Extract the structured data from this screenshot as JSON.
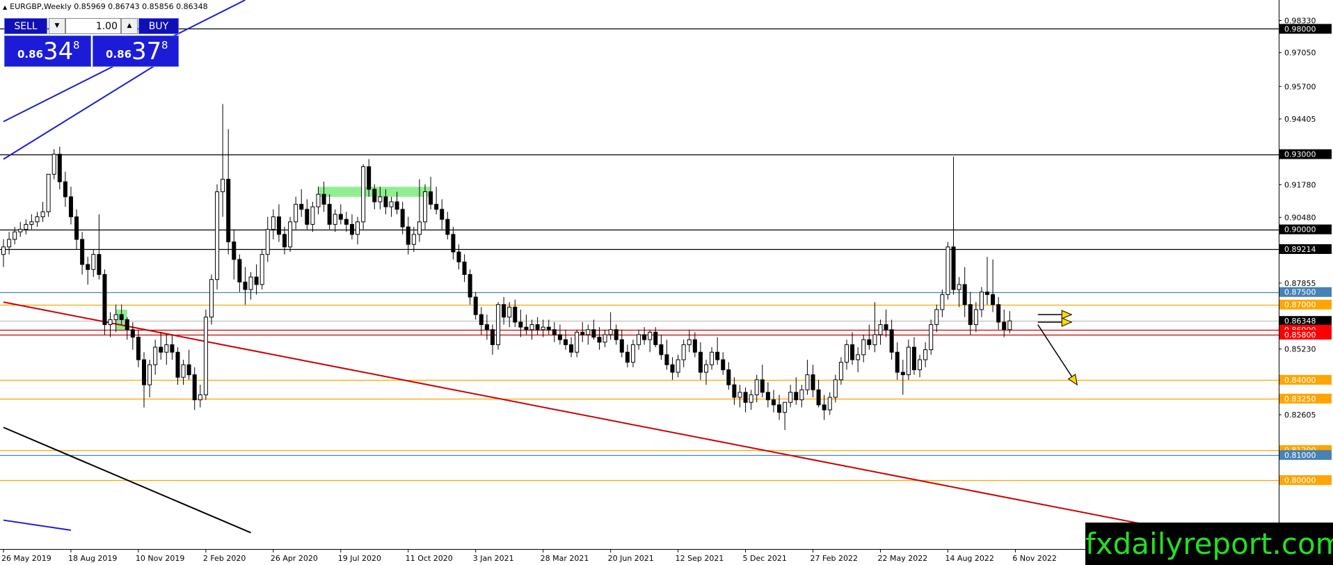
{
  "header": {
    "symbol_line": "EURGBP,Weekly  0.85969 0.86743 0.85856 0.86348"
  },
  "trade_panel": {
    "sell_label": "SELL",
    "buy_label": "BUY",
    "lot_value": "1.00",
    "bid_prefix": "0.86",
    "bid_big": "34",
    "bid_sup": "8",
    "ask_prefix": "0.86",
    "ask_big": "37",
    "ask_sup": "8"
  },
  "watermark": "fxdailyreport.com",
  "chart_data": {
    "type": "candlestick",
    "title": "EURGBP,Weekly",
    "ohlc_readout": [
      0.85969,
      0.86743,
      0.85856,
      0.86348
    ],
    "ylim": [
      0.7725,
      0.9915
    ],
    "price_scale_labels": [
      "0.98330",
      "0.97050",
      "0.95700",
      "0.94405",
      "0.91780",
      "0.90480",
      "0.87855",
      "0.85230",
      "0.82605",
      "0.81200",
      "0.80000"
    ],
    "x_labels": [
      {
        "label": "26 May 2019",
        "i": 0
      },
      {
        "label": "18 Aug 2019",
        "i": 12
      },
      {
        "label": "10 Nov 2019",
        "i": 24
      },
      {
        "label": "2 Feb 2020",
        "i": 36
      },
      {
        "label": "26 Apr 2020",
        "i": 48
      },
      {
        "label": "19 Jul 2020",
        "i": 60
      },
      {
        "label": "11 Oct 2020",
        "i": 72
      },
      {
        "label": "3 Jan 2021",
        "i": 84
      },
      {
        "label": "28 Mar 2021",
        "i": 96
      },
      {
        "label": "20 Jun 2021",
        "i": 108
      },
      {
        "label": "12 Sep 2021",
        "i": 120
      },
      {
        "label": "5 Dec 2021",
        "i": 132
      },
      {
        "label": "27 Feb 2022",
        "i": 144
      },
      {
        "label": "22 May 2022",
        "i": 156
      },
      {
        "label": "14 Aug 2022",
        "i": 168
      },
      {
        "label": "6 Nov 2022",
        "i": 180
      }
    ],
    "levels": [
      {
        "price": 0.98,
        "label": "0.98000",
        "color": "#000000",
        "label_bg": "#000000",
        "label_fg": "#ffffff"
      },
      {
        "price": 0.93,
        "label": "0.93000",
        "color": "#000000",
        "label_bg": "#000000",
        "label_fg": "#ffffff"
      },
      {
        "price": 0.9,
        "label": "0.90000",
        "color": "#000000",
        "label_bg": "#000000",
        "label_fg": "#ffffff"
      },
      {
        "price": 0.89214,
        "label": "0.89214",
        "color": "#000000",
        "label_bg": "#000000",
        "label_fg": "#ffffff"
      },
      {
        "price": 0.875,
        "label": "0.87500",
        "color": "#4682b4",
        "label_bg": "#4682b4",
        "label_fg": "#ffffff"
      },
      {
        "price": 0.87,
        "label": "0.87000",
        "color": "#ffa500",
        "label_bg": "#ffa500",
        "label_fg": "#ffffff"
      },
      {
        "price": 0.86348,
        "label": "0.86348",
        "color": "#c0c0c0",
        "label_bg": "#000000",
        "label_fg": "#ffffff"
      },
      {
        "price": 0.86,
        "label": "0.86000",
        "color": "#cc0000",
        "label_bg": "#ff0000",
        "label_fg": "#ffffff"
      },
      {
        "price": 0.858,
        "label": "0.85800",
        "color": "#cc0000",
        "label_bg": "#ff0000",
        "label_fg": "#ffffff"
      },
      {
        "price": 0.84,
        "label": "0.84000",
        "color": "#ffa500",
        "label_bg": "#ffa500",
        "label_fg": "#ffffff"
      },
      {
        "price": 0.8325,
        "label": "0.83250",
        "color": "#ffa500",
        "label_bg": "#ffa500",
        "label_fg": "#ffffff"
      },
      {
        "price": 0.812,
        "label": "0.81200",
        "color": "#ffa500",
        "label_bg": "#ffa500",
        "label_fg": "#ffffff"
      },
      {
        "price": 0.81,
        "label": "0.81000",
        "color": "#4682b4",
        "label_bg": "#4682b4",
        "label_fg": "#ffffff"
      },
      {
        "price": 0.8,
        "label": "0.80000",
        "color": "#ffa500",
        "label_bg": "#ffa500",
        "label_fg": "#ffffff"
      }
    ],
    "trendlines": [
      {
        "color": "#1c1cd8",
        "i1": 0,
        "p1": 0.943,
        "i2": 43,
        "p2": 0.9915
      },
      {
        "color": "#1c1cd8",
        "i1": 0,
        "p1": 0.928,
        "i2": 31,
        "p2": 0.971
      },
      {
        "color": "#1c1cd8",
        "i1": 0,
        "p1": 0.784,
        "i2": 12,
        "p2": 0.78
      },
      {
        "color": "#cc0000",
        "i1": 0,
        "p1": 0.871,
        "i2": 206,
        "p2": 0.781
      },
      {
        "color": "#000000",
        "i1": 0,
        "p1": 0.821,
        "i2": 44,
        "p2": 0.779
      }
    ],
    "zones": [
      {
        "i1": 56,
        "i2": 76,
        "p1": 0.917,
        "p2": 0.913,
        "color": "#90ee90"
      },
      {
        "i1": 20,
        "i2": 22,
        "p1": 0.868,
        "p2": 0.86,
        "color": "#90ee90"
      }
    ],
    "arrows": [
      {
        "i1": 184,
        "p1": 0.866,
        "i2": 190,
        "p2": 0.866,
        "color": "#ffd700"
      },
      {
        "i1": 184,
        "p1": 0.863,
        "i2": 190,
        "p2": 0.863,
        "color": "#ffd700"
      },
      {
        "i1": 184,
        "p1": 0.862,
        "i2": 191,
        "p2": 0.838,
        "color": "#ffd700"
      }
    ],
    "candles": [
      [
        0.89,
        0.896,
        0.885,
        0.893
      ],
      [
        0.893,
        0.899,
        0.89,
        0.896
      ],
      [
        0.896,
        0.901,
        0.894,
        0.899
      ],
      [
        0.899,
        0.903,
        0.897,
        0.9
      ],
      [
        0.9,
        0.904,
        0.898,
        0.902
      ],
      [
        0.902,
        0.906,
        0.9,
        0.903
      ],
      [
        0.903,
        0.907,
        0.901,
        0.905
      ],
      [
        0.905,
        0.911,
        0.903,
        0.907
      ],
      [
        0.907,
        0.917,
        0.905,
        0.922
      ],
      [
        0.922,
        0.932,
        0.92,
        0.93
      ],
      [
        0.93,
        0.933,
        0.916,
        0.919
      ],
      [
        0.919,
        0.923,
        0.909,
        0.913
      ],
      [
        0.913,
        0.917,
        0.902,
        0.905
      ],
      [
        0.905,
        0.908,
        0.892,
        0.896
      ],
      [
        0.896,
        0.899,
        0.882,
        0.886
      ],
      [
        0.886,
        0.889,
        0.878,
        0.884
      ],
      [
        0.884,
        0.892,
        0.881,
        0.89
      ],
      [
        0.89,
        0.906,
        0.88,
        0.882
      ],
      [
        0.882,
        0.884,
        0.858,
        0.862
      ],
      [
        0.862,
        0.867,
        0.857,
        0.864
      ],
      [
        0.864,
        0.87,
        0.859,
        0.866
      ],
      [
        0.866,
        0.87,
        0.862,
        0.864
      ],
      [
        0.864,
        0.865,
        0.856,
        0.86
      ],
      [
        0.86,
        0.863,
        0.852,
        0.857
      ],
      [
        0.857,
        0.86,
        0.845,
        0.848
      ],
      [
        0.848,
        0.851,
        0.829,
        0.838
      ],
      [
        0.838,
        0.848,
        0.833,
        0.846
      ],
      [
        0.846,
        0.856,
        0.842,
        0.853
      ],
      [
        0.853,
        0.859,
        0.848,
        0.851
      ],
      [
        0.851,
        0.858,
        0.846,
        0.854
      ],
      [
        0.854,
        0.858,
        0.848,
        0.851
      ],
      [
        0.851,
        0.853,
        0.838,
        0.841
      ],
      [
        0.841,
        0.848,
        0.838,
        0.846
      ],
      [
        0.846,
        0.852,
        0.84,
        0.842
      ],
      [
        0.842,
        0.845,
        0.828,
        0.832
      ],
      [
        0.832,
        0.838,
        0.829,
        0.834
      ],
      [
        0.834,
        0.868,
        0.832,
        0.865
      ],
      [
        0.865,
        0.882,
        0.862,
        0.88
      ],
      [
        0.88,
        0.918,
        0.876,
        0.915
      ],
      [
        0.915,
        0.95,
        0.905,
        0.92
      ],
      [
        0.92,
        0.94,
        0.89,
        0.895
      ],
      [
        0.895,
        0.9,
        0.88,
        0.888
      ],
      [
        0.888,
        0.89,
        0.875,
        0.879
      ],
      [
        0.879,
        0.885,
        0.87,
        0.876
      ],
      [
        0.876,
        0.883,
        0.872,
        0.881
      ],
      [
        0.881,
        0.886,
        0.874,
        0.878
      ],
      [
        0.878,
        0.892,
        0.876,
        0.89
      ],
      [
        0.89,
        0.905,
        0.887,
        0.9
      ],
      [
        0.9,
        0.908,
        0.896,
        0.905
      ],
      [
        0.905,
        0.91,
        0.895,
        0.898
      ],
      [
        0.898,
        0.901,
        0.89,
        0.893
      ],
      [
        0.893,
        0.905,
        0.891,
        0.903
      ],
      [
        0.903,
        0.913,
        0.9,
        0.91
      ],
      [
        0.91,
        0.916,
        0.905,
        0.908
      ],
      [
        0.908,
        0.912,
        0.9,
        0.902
      ],
      [
        0.902,
        0.911,
        0.899,
        0.909
      ],
      [
        0.909,
        0.917,
        0.906,
        0.914
      ],
      [
        0.914,
        0.919,
        0.907,
        0.91
      ],
      [
        0.91,
        0.914,
        0.9,
        0.902
      ],
      [
        0.902,
        0.908,
        0.899,
        0.906
      ],
      [
        0.906,
        0.91,
        0.902,
        0.904
      ],
      [
        0.904,
        0.907,
        0.899,
        0.902
      ],
      [
        0.902,
        0.906,
        0.896,
        0.898
      ],
      [
        0.898,
        0.905,
        0.894,
        0.903
      ],
      [
        0.903,
        0.926,
        0.9,
        0.925
      ],
      [
        0.925,
        0.928,
        0.913,
        0.916
      ],
      [
        0.916,
        0.918,
        0.908,
        0.911
      ],
      [
        0.911,
        0.917,
        0.908,
        0.913
      ],
      [
        0.913,
        0.916,
        0.906,
        0.909
      ],
      [
        0.909,
        0.913,
        0.905,
        0.911
      ],
      [
        0.911,
        0.915,
        0.906,
        0.908
      ],
      [
        0.908,
        0.911,
        0.898,
        0.901
      ],
      [
        0.901,
        0.905,
        0.89,
        0.894
      ],
      [
        0.894,
        0.901,
        0.891,
        0.898
      ],
      [
        0.898,
        0.92,
        0.895,
        0.903
      ],
      [
        0.903,
        0.918,
        0.9,
        0.915
      ],
      [
        0.915,
        0.921,
        0.908,
        0.91
      ],
      [
        0.91,
        0.917,
        0.906,
        0.908
      ],
      [
        0.908,
        0.912,
        0.9,
        0.904
      ],
      [
        0.904,
        0.907,
        0.896,
        0.898
      ],
      [
        0.898,
        0.901,
        0.888,
        0.891
      ],
      [
        0.891,
        0.894,
        0.884,
        0.887
      ],
      [
        0.887,
        0.89,
        0.879,
        0.882
      ],
      [
        0.882,
        0.884,
        0.87,
        0.873
      ],
      [
        0.873,
        0.875,
        0.864,
        0.866
      ],
      [
        0.866,
        0.869,
        0.858,
        0.862
      ],
      [
        0.862,
        0.866,
        0.856,
        0.86
      ],
      [
        0.86,
        0.862,
        0.85,
        0.854
      ],
      [
        0.854,
        0.871,
        0.852,
        0.87
      ],
      [
        0.87,
        0.873,
        0.862,
        0.865
      ],
      [
        0.865,
        0.871,
        0.861,
        0.869
      ],
      [
        0.869,
        0.872,
        0.861,
        0.863
      ],
      [
        0.863,
        0.868,
        0.857,
        0.861
      ],
      [
        0.861,
        0.866,
        0.858,
        0.86
      ],
      [
        0.86,
        0.864,
        0.856,
        0.862
      ],
      [
        0.862,
        0.865,
        0.858,
        0.86
      ],
      [
        0.86,
        0.864,
        0.857,
        0.861
      ],
      [
        0.861,
        0.864,
        0.858,
        0.86
      ],
      [
        0.86,
        0.863,
        0.855,
        0.858
      ],
      [
        0.858,
        0.862,
        0.854,
        0.856
      ],
      [
        0.856,
        0.86,
        0.852,
        0.854
      ],
      [
        0.854,
        0.857,
        0.849,
        0.851
      ],
      [
        0.851,
        0.86,
        0.849,
        0.859
      ],
      [
        0.859,
        0.863,
        0.855,
        0.858
      ],
      [
        0.858,
        0.862,
        0.854,
        0.86
      ],
      [
        0.86,
        0.864,
        0.856,
        0.857
      ],
      [
        0.857,
        0.861,
        0.852,
        0.855
      ],
      [
        0.855,
        0.86,
        0.853,
        0.858
      ],
      [
        0.858,
        0.867,
        0.856,
        0.86
      ],
      [
        0.86,
        0.862,
        0.854,
        0.856
      ],
      [
        0.856,
        0.86,
        0.849,
        0.851
      ],
      [
        0.851,
        0.854,
        0.845,
        0.847
      ],
      [
        0.847,
        0.856,
        0.845,
        0.854
      ],
      [
        0.854,
        0.86,
        0.852,
        0.858
      ],
      [
        0.858,
        0.861,
        0.854,
        0.856
      ],
      [
        0.856,
        0.86,
        0.851,
        0.859
      ],
      [
        0.859,
        0.861,
        0.853,
        0.854
      ],
      [
        0.854,
        0.858,
        0.848,
        0.85
      ],
      [
        0.85,
        0.856,
        0.844,
        0.846
      ],
      [
        0.846,
        0.849,
        0.84,
        0.843
      ],
      [
        0.843,
        0.85,
        0.841,
        0.848
      ],
      [
        0.848,
        0.856,
        0.845,
        0.854
      ],
      [
        0.854,
        0.86,
        0.851,
        0.856
      ],
      [
        0.856,
        0.859,
        0.849,
        0.851
      ],
      [
        0.851,
        0.855,
        0.84,
        0.843
      ],
      [
        0.843,
        0.848,
        0.838,
        0.846
      ],
      [
        0.846,
        0.853,
        0.844,
        0.851
      ],
      [
        0.851,
        0.857,
        0.846,
        0.848
      ],
      [
        0.848,
        0.851,
        0.842,
        0.844
      ],
      [
        0.844,
        0.847,
        0.836,
        0.838
      ],
      [
        0.838,
        0.841,
        0.83,
        0.833
      ],
      [
        0.833,
        0.838,
        0.829,
        0.835
      ],
      [
        0.835,
        0.837,
        0.827,
        0.831
      ],
      [
        0.831,
        0.836,
        0.828,
        0.834
      ],
      [
        0.834,
        0.842,
        0.831,
        0.84
      ],
      [
        0.84,
        0.846,
        0.833,
        0.835
      ],
      [
        0.835,
        0.839,
        0.829,
        0.832
      ],
      [
        0.832,
        0.836,
        0.827,
        0.83
      ],
      [
        0.83,
        0.834,
        0.824,
        0.827
      ],
      [
        0.827,
        0.83,
        0.82,
        0.831
      ],
      [
        0.831,
        0.838,
        0.829,
        0.835
      ],
      [
        0.835,
        0.841,
        0.83,
        0.832
      ],
      [
        0.832,
        0.838,
        0.829,
        0.836
      ],
      [
        0.836,
        0.848,
        0.834,
        0.842
      ],
      [
        0.842,
        0.846,
        0.833,
        0.836
      ],
      [
        0.836,
        0.84,
        0.829,
        0.83
      ],
      [
        0.83,
        0.834,
        0.824,
        0.828
      ],
      [
        0.828,
        0.835,
        0.826,
        0.833
      ],
      [
        0.833,
        0.842,
        0.831,
        0.84
      ],
      [
        0.84,
        0.849,
        0.838,
        0.847
      ],
      [
        0.847,
        0.856,
        0.844,
        0.854
      ],
      [
        0.854,
        0.859,
        0.846,
        0.848
      ],
      [
        0.848,
        0.853,
        0.843,
        0.85
      ],
      [
        0.85,
        0.858,
        0.847,
        0.856
      ],
      [
        0.856,
        0.862,
        0.852,
        0.854
      ],
      [
        0.854,
        0.871,
        0.851,
        0.858
      ],
      [
        0.858,
        0.864,
        0.854,
        0.862
      ],
      [
        0.862,
        0.868,
        0.857,
        0.86
      ],
      [
        0.86,
        0.864,
        0.848,
        0.851
      ],
      [
        0.851,
        0.855,
        0.84,
        0.843
      ],
      [
        0.843,
        0.848,
        0.834,
        0.842
      ],
      [
        0.842,
        0.856,
        0.84,
        0.853
      ],
      [
        0.853,
        0.857,
        0.842,
        0.844
      ],
      [
        0.844,
        0.85,
        0.841,
        0.848
      ],
      [
        0.848,
        0.855,
        0.845,
        0.852
      ],
      [
        0.852,
        0.864,
        0.85,
        0.862
      ],
      [
        0.862,
        0.87,
        0.859,
        0.868
      ],
      [
        0.868,
        0.876,
        0.865,
        0.874
      ],
      [
        0.874,
        0.895,
        0.872,
        0.893
      ],
      [
        0.893,
        0.929,
        0.874,
        0.876
      ],
      [
        0.876,
        0.881,
        0.869,
        0.878
      ],
      [
        0.878,
        0.885,
        0.865,
        0.87
      ],
      [
        0.87,
        0.875,
        0.858,
        0.862
      ],
      [
        0.862,
        0.871,
        0.859,
        0.868
      ],
      [
        0.868,
        0.877,
        0.865,
        0.875
      ],
      [
        0.875,
        0.889,
        0.87,
        0.874
      ],
      [
        0.874,
        0.888,
        0.867,
        0.87
      ],
      [
        0.87,
        0.873,
        0.86,
        0.863
      ],
      [
        0.863,
        0.868,
        0.857,
        0.86
      ],
      [
        0.86,
        0.8674,
        0.8586,
        0.8635
      ]
    ]
  }
}
